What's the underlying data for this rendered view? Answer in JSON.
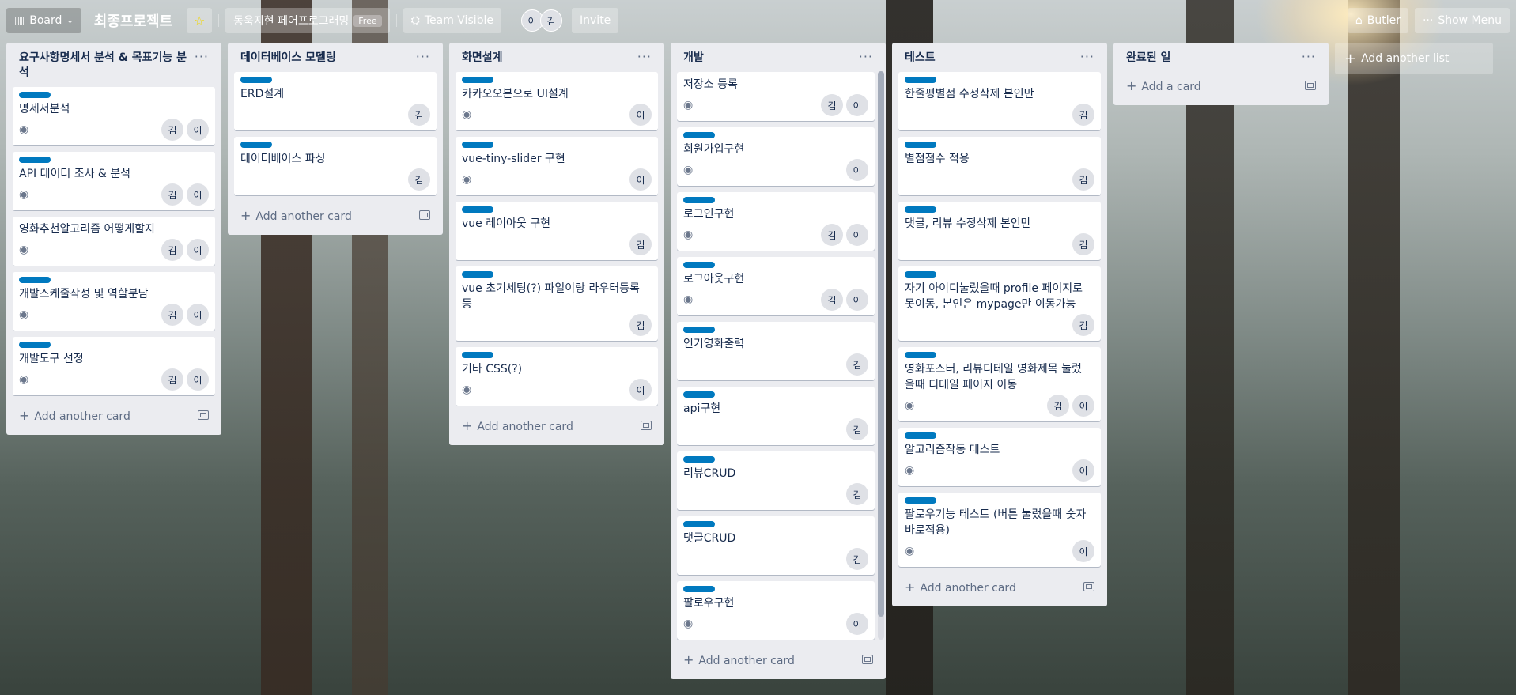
{
  "header": {
    "board_switcher": "Board",
    "board_title": "최종프로젝트",
    "workspace": "동욱지현 페어프로그래밍",
    "workspace_badge": "Free",
    "visibility": "Team Visible",
    "members": [
      "이",
      "김"
    ],
    "invite": "Invite",
    "butler": "Butler",
    "show_menu": "Show Menu"
  },
  "lists": [
    {
      "title": "요구사항명세서 분석 & 목표기능 분석",
      "add_label": "Add another card",
      "cards": [
        {
          "title": "명세서분석",
          "label": true,
          "watch": true,
          "members": [
            "김",
            "이"
          ]
        },
        {
          "title": "API 데이터 조사 & 분석",
          "label": true,
          "watch": true,
          "members": [
            "김",
            "이"
          ]
        },
        {
          "title": "영화추천알고리즘 어떻게할지",
          "label": false,
          "watch": true,
          "members": [
            "김",
            "이"
          ]
        },
        {
          "title": "개발스케줄작성 및 역할분담",
          "label": true,
          "watch": true,
          "members": [
            "김",
            "이"
          ]
        },
        {
          "title": "개발도구 선정",
          "label": true,
          "watch": true,
          "members": [
            "김",
            "이"
          ]
        }
      ]
    },
    {
      "title": "데이터베이스 모델링",
      "add_label": "Add another card",
      "cards": [
        {
          "title": "ERD설계",
          "label": true,
          "watch": false,
          "members": [
            "김"
          ]
        },
        {
          "title": "데이터베이스 파싱",
          "label": true,
          "watch": false,
          "members": [
            "김"
          ]
        }
      ]
    },
    {
      "title": "화면설계",
      "add_label": "Add another card",
      "cards": [
        {
          "title": "카카오오븐으로 UI설계",
          "label": true,
          "watch": true,
          "members": [
            "이"
          ]
        },
        {
          "title": "vue-tiny-slider 구현",
          "label": true,
          "watch": true,
          "members": [
            "이"
          ]
        },
        {
          "title": "vue 레이아웃 구현",
          "label": true,
          "watch": false,
          "members": [
            "김"
          ]
        },
        {
          "title": "vue 초기세팅(?) 파일이랑 라우터등록등",
          "label": true,
          "watch": false,
          "members": [
            "김"
          ]
        },
        {
          "title": "기타 CSS(?)",
          "label": true,
          "watch": true,
          "members": [
            "이"
          ]
        }
      ]
    },
    {
      "title": "개발",
      "add_label": "Add another card",
      "cards": [
        {
          "title": "저장소 등록",
          "label": false,
          "watch": true,
          "members": [
            "김",
            "이"
          ]
        },
        {
          "title": "회원가입구현",
          "label": true,
          "watch": true,
          "members": [
            "이"
          ]
        },
        {
          "title": "로그인구현",
          "label": true,
          "watch": true,
          "members": [
            "김",
            "이"
          ]
        },
        {
          "title": "로그아웃구현",
          "label": true,
          "watch": true,
          "members": [
            "김",
            "이"
          ]
        },
        {
          "title": "인기영화출력",
          "label": true,
          "watch": false,
          "members": [
            "김"
          ]
        },
        {
          "title": "api구현",
          "label": true,
          "watch": false,
          "members": [
            "김"
          ]
        },
        {
          "title": "리뷰CRUD",
          "label": true,
          "watch": false,
          "members": [
            "김"
          ]
        },
        {
          "title": "댓글CRUD",
          "label": true,
          "watch": false,
          "members": [
            "김"
          ]
        },
        {
          "title": "팔로우구현",
          "label": true,
          "watch": true,
          "members": [
            "이"
          ]
        }
      ]
    },
    {
      "title": "테스트",
      "add_label": "Add another card",
      "cards": [
        {
          "title": "한줄평별점 수정삭제 본인만",
          "label": true,
          "watch": false,
          "members": [
            "김"
          ]
        },
        {
          "title": "별점점수 적용",
          "label": true,
          "watch": false,
          "members": [
            "김"
          ]
        },
        {
          "title": "댓글, 리뷰 수정삭제 본인만",
          "label": true,
          "watch": false,
          "members": [
            "김"
          ]
        },
        {
          "title": "자기 아이디눌렀을때 profile 페이지로 못이동, 본인은 mypage만 이동가능",
          "label": true,
          "watch": false,
          "members": [
            "김"
          ]
        },
        {
          "title": "영화포스터, 리뷰디테일 영화제목 눌렀을때 디테일 페이지 이동",
          "label": true,
          "watch": true,
          "members": [
            "김",
            "이"
          ]
        },
        {
          "title": "알고리즘작동 테스트",
          "label": true,
          "watch": true,
          "members": [
            "이"
          ]
        },
        {
          "title": "팔로우기능 테스트 (버튼 눌렀을때 숫자바로적용)",
          "label": true,
          "watch": true,
          "members": [
            "이"
          ]
        }
      ]
    },
    {
      "title": "완료된 일",
      "add_label": "Add a card",
      "cards": []
    }
  ],
  "add_list_label": "Add another list",
  "icons": {
    "board": "board-icon",
    "star": "star-icon",
    "visibility": "team-visibility-icon",
    "butler": "butler-icon",
    "menu": "more-icon",
    "watch": "eye-icon",
    "template": "card-template-icon"
  },
  "colors": {
    "label": "#0079bf",
    "list_bg": "#ebecf0",
    "star": "#f2d600"
  }
}
